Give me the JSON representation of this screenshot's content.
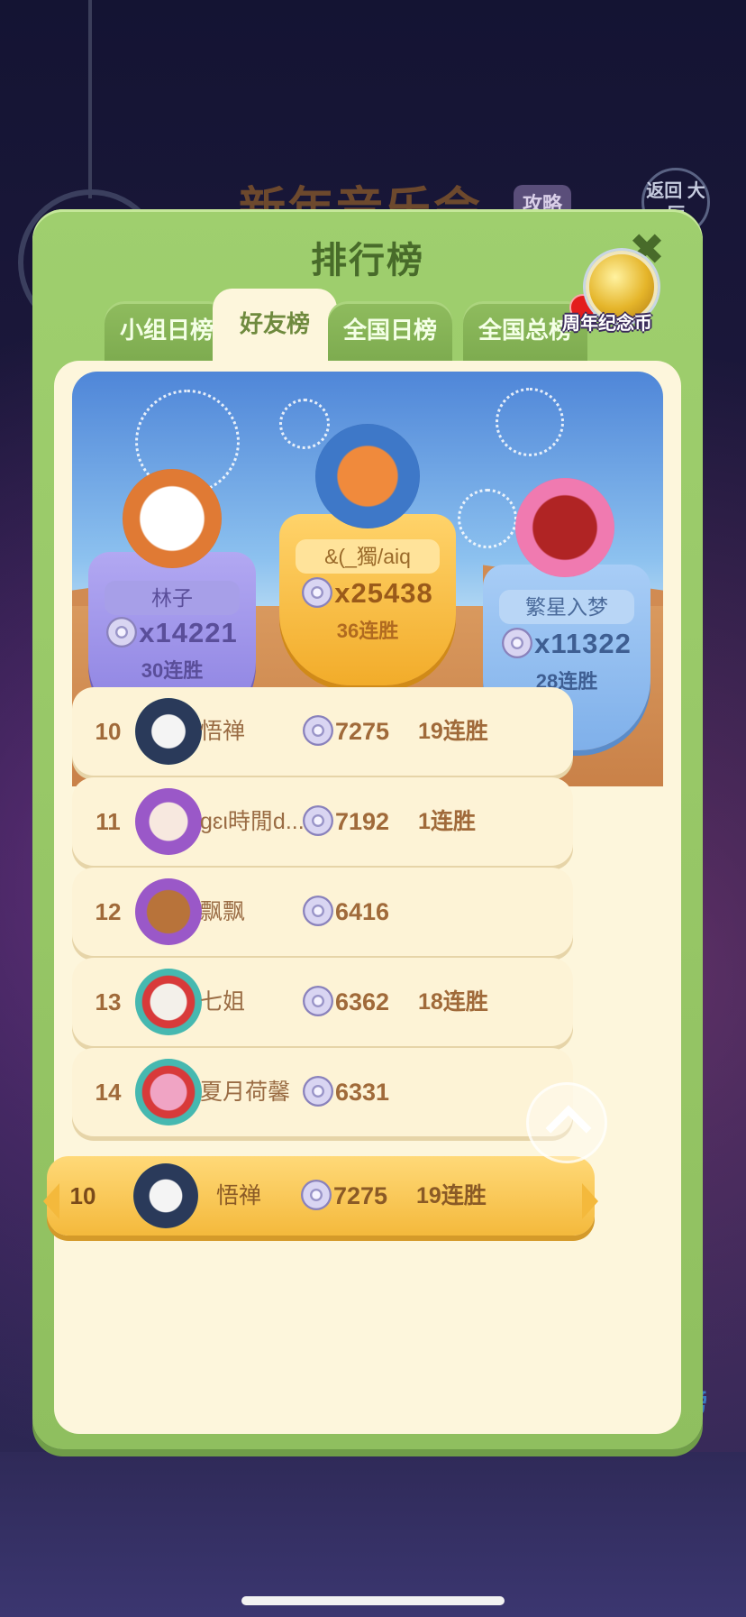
{
  "panel": {
    "title": "排行榜"
  },
  "tabs": [
    {
      "label": "小组日榜",
      "active": false
    },
    {
      "label": "好友榜",
      "active": true
    },
    {
      "label": "全国日榜",
      "active": false
    },
    {
      "label": "全国总榜",
      "active": false,
      "has_notification_dot": true
    }
  ],
  "side_badge": {
    "label": "周年纪念币",
    "icon": "coin-icon"
  },
  "podium": [
    {
      "place": 1,
      "name": "&(_獨/aiq",
      "score": "x25438",
      "streak": "36连胜"
    },
    {
      "place": 2,
      "name": "林子",
      "score": "x14221",
      "streak": "30连胜"
    },
    {
      "place": 3,
      "name": "繁星入梦",
      "score": "x11322",
      "streak": "28连胜"
    }
  ],
  "rows": [
    {
      "rank": "10",
      "name": "悟禅",
      "score": "7275",
      "streak": "19连胜"
    },
    {
      "rank": "11",
      "name": "gɛι時閒d...",
      "score": "7192",
      "streak": "1连胜"
    },
    {
      "rank": "12",
      "name": "飘飘",
      "score": "6416",
      "streak": ""
    },
    {
      "rank": "13",
      "name": "七姐",
      "score": "6362",
      "streak": "18连胜"
    },
    {
      "rank": "14",
      "name": "夏月荷馨",
      "score": "6331",
      "streak": ""
    }
  ],
  "my_row": {
    "rank": "10",
    "name": "悟禅",
    "score": "7275",
    "streak": "19连胜"
  },
  "background": {
    "event_title": "新年音乐会",
    "guide_label": "攻略",
    "back_label": "返回 大厅",
    "side_label": "排行榜"
  },
  "colors": {
    "panel_green": "#9fcf6e",
    "cream": "#fdf6dc",
    "gold": "#f4b93c",
    "purple_shield": "#9a8ee8",
    "blue_shield": "#8cb8ee",
    "brown_text": "#a06a3a"
  }
}
